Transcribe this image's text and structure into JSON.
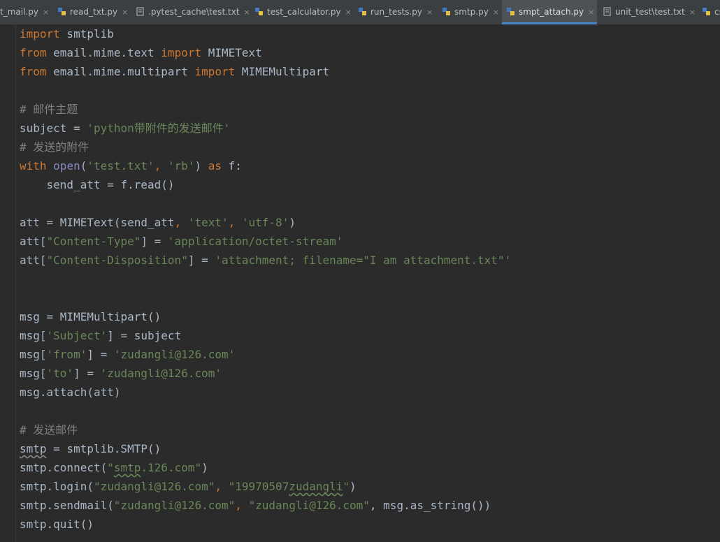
{
  "tabs": [
    {
      "label": "t_mail.py",
      "icon": "python-file-icon"
    },
    {
      "label": "read_txt.py",
      "icon": "python-file-icon"
    },
    {
      "label": ".pytest_cache\\test.txt",
      "icon": "text-file-icon"
    },
    {
      "label": "test_calculator.py",
      "icon": "python-file-icon"
    },
    {
      "label": "run_tests.py",
      "icon": "python-file-icon"
    },
    {
      "label": "smtp.py",
      "icon": "python-file-icon"
    },
    {
      "label": "smpt_attach.py",
      "icon": "python-file-icon",
      "active": true
    },
    {
      "label": "unit_test\\test.txt",
      "icon": "text-file-icon"
    },
    {
      "label": "cs",
      "icon": "python-file-icon"
    }
  ],
  "close_glyph": "×",
  "colors": {
    "keyword": "#cc7832",
    "string": "#6a8759",
    "comment": "#808080",
    "builtin": "#8888c6",
    "text": "#a9b7c6",
    "background": "#2b2b2b",
    "active_tab_underline": "#4a88c7"
  },
  "code": {
    "l1": {
      "t1": "import",
      "t2": " smtplib"
    },
    "l2": {
      "t1": "from",
      "t2": " email.mime.text ",
      "t3": "import",
      "t4": " MIMEText"
    },
    "l3": {
      "t1": "from",
      "t2": " email.mime.multipart ",
      "t3": "import",
      "t4": " MIMEMultipart"
    },
    "l5": {
      "t1": "# 邮件主题"
    },
    "l6": {
      "t1": "subject = ",
      "t2": "'python带附件的发送邮件'"
    },
    "l7": {
      "t1": "# 发送的附件"
    },
    "l8": {
      "t1": "with",
      "t2": " ",
      "t3": "open",
      "t4": "(",
      "t5": "'test.txt'",
      "t6": ", ",
      "t7": "'rb'",
      "t8": ") ",
      "t9": "as",
      "t10": " f:"
    },
    "l9": {
      "t1": "    send_att = f.read()"
    },
    "l11": {
      "t1": "att = MIMEText(send_att",
      "t2": ", ",
      "t3": "'text'",
      "t4": ", ",
      "t5": "'utf-8'",
      "t6": ")"
    },
    "l12": {
      "t1": "att[",
      "t2": "\"Content-Type\"",
      "t3": "] = ",
      "t4": "'application/octet-stream'"
    },
    "l13": {
      "t1": "att[",
      "t2": "\"Content-Disposition\"",
      "t3": "] = ",
      "t4": "'attachment; filename=\"I am attachment.txt\"'"
    },
    "l16": {
      "t1": "msg = MIMEMultipart()"
    },
    "l17": {
      "t1": "msg[",
      "t2": "'Subject'",
      "t3": "] = subject"
    },
    "l18": {
      "t1": "msg[",
      "t2": "'from'",
      "t3": "] = ",
      "t4": "'zudangli@126.com'"
    },
    "l19": {
      "t1": "msg[",
      "t2": "'to'",
      "t3": "] = ",
      "t4": "'zudangli@126.com'"
    },
    "l20": {
      "t1": "msg.attach(att)"
    },
    "l22": {
      "t1": "# 发送邮件"
    },
    "l23": {
      "t1": "smtp",
      "t2": " = smtplib.SMTP()"
    },
    "l24": {
      "t1": "smtp.connect(",
      "t2": "\"",
      "t3": "smtp",
      "t4": ".126.com\"",
      "t5": ")"
    },
    "l25": {
      "t1": "smtp.login(",
      "t2": "\"zudangli@126.com\"",
      "t3": ", ",
      "t4": "\"19970507",
      "t5": "zudangli",
      "t6": "\"",
      "t7": ")"
    },
    "l26": {
      "t1": "smtp.sendmail(",
      "t2": "\"zudangli@126.com\"",
      "t3": ", ",
      "t4": "\"zudangli@126.com\"",
      "t5": ", msg.as_string())"
    },
    "l27": {
      "t1": "smtp.quit()"
    }
  }
}
